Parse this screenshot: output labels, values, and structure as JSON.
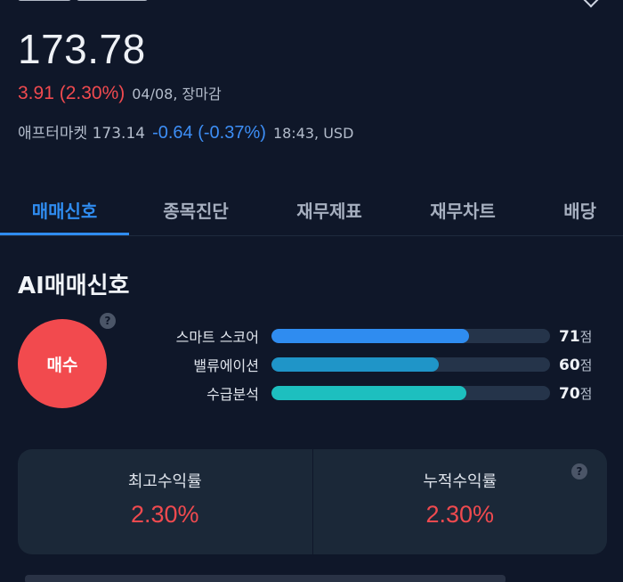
{
  "quote": {
    "price": "173.78",
    "change": "3.91 (2.30%)",
    "date_status": "04/08, 장마감",
    "after_label": "애프터마켓 173.14",
    "after_change": "-0.64 (-0.37%)",
    "after_time": "18:43, USD"
  },
  "tabs": [
    {
      "label": "매매신호",
      "active": true
    },
    {
      "label": "종목진단",
      "active": false
    },
    {
      "label": "재무제표",
      "active": false
    },
    {
      "label": "재무차트",
      "active": false
    },
    {
      "label": "배당",
      "active": false
    }
  ],
  "ai_signal": {
    "title": "AI매매신호",
    "signal": "매수",
    "help_icon": "question-icon",
    "metrics": [
      {
        "label": "스마트 스코어",
        "score": 71,
        "unit": "점",
        "color": "#2f8cf0"
      },
      {
        "label": "밸류에이션",
        "score": 60,
        "unit": "점",
        "color": "#1f95c8"
      },
      {
        "label": "수급분석",
        "score": 70,
        "unit": "점",
        "color": "#1dbfbf"
      }
    ]
  },
  "returns": {
    "best_label": "최고수익률",
    "best_value": "2.30%",
    "cumulative_label": "누적수익률",
    "cumulative_value": "2.30%"
  },
  "colors": {
    "up": "#f04a4f",
    "down": "#3d8ef5",
    "accent": "#2f8cf0",
    "background": "#0f1729"
  }
}
